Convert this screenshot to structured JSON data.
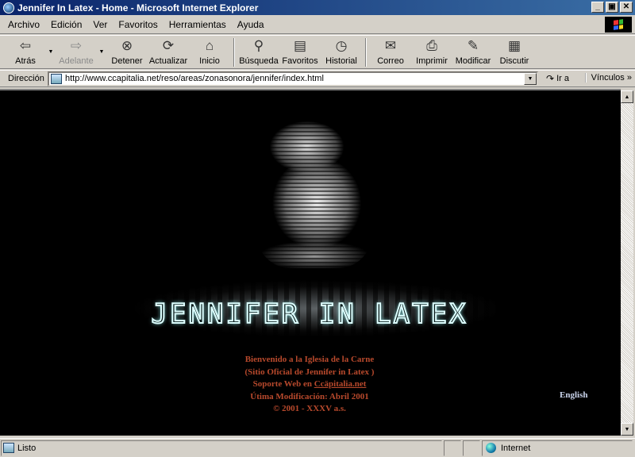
{
  "window": {
    "title": "Jennifer In Latex - Home - Microsoft Internet Explorer",
    "controls": [
      "_",
      "▣",
      "✕"
    ]
  },
  "menu": [
    "Archivo",
    "Edición",
    "Ver",
    "Favoritos",
    "Herramientas",
    "Ayuda"
  ],
  "toolbar": {
    "back": "Atrás",
    "forward": "Adelante",
    "stop": "Detener",
    "refresh": "Actualizar",
    "home": "Inicio",
    "search": "Búsqueda",
    "favorites": "Favoritos",
    "history": "Historial",
    "mail": "Correo",
    "print": "Imprimir",
    "edit": "Modificar",
    "discuss": "Discutir"
  },
  "address": {
    "label": "Dirección",
    "url": "http://www.ccapitalia.net/reso/areas/zonasonora/jennifer/index.html",
    "go": "Ir a",
    "links": "Vínculos"
  },
  "page": {
    "logo": "JENNIFER IN LATEX",
    "intro": [
      "Bienvenido a la Iglesia de la Carne",
      "(Sitio Oficial de Jennifer in Latex )",
      "Soporte Web en",
      "Ccäpitalia.net",
      "Útima Modificación: Abril 2001",
      "© 2001 - XXXV a.s."
    ],
    "english_link": "English"
  },
  "status": {
    "text": "Listo",
    "zone": "Internet"
  },
  "colors": {
    "title_bar": "#0a246a",
    "page_bg": "#000000",
    "intro_text": "#b8492c",
    "english_link": "#ccd6ee"
  }
}
